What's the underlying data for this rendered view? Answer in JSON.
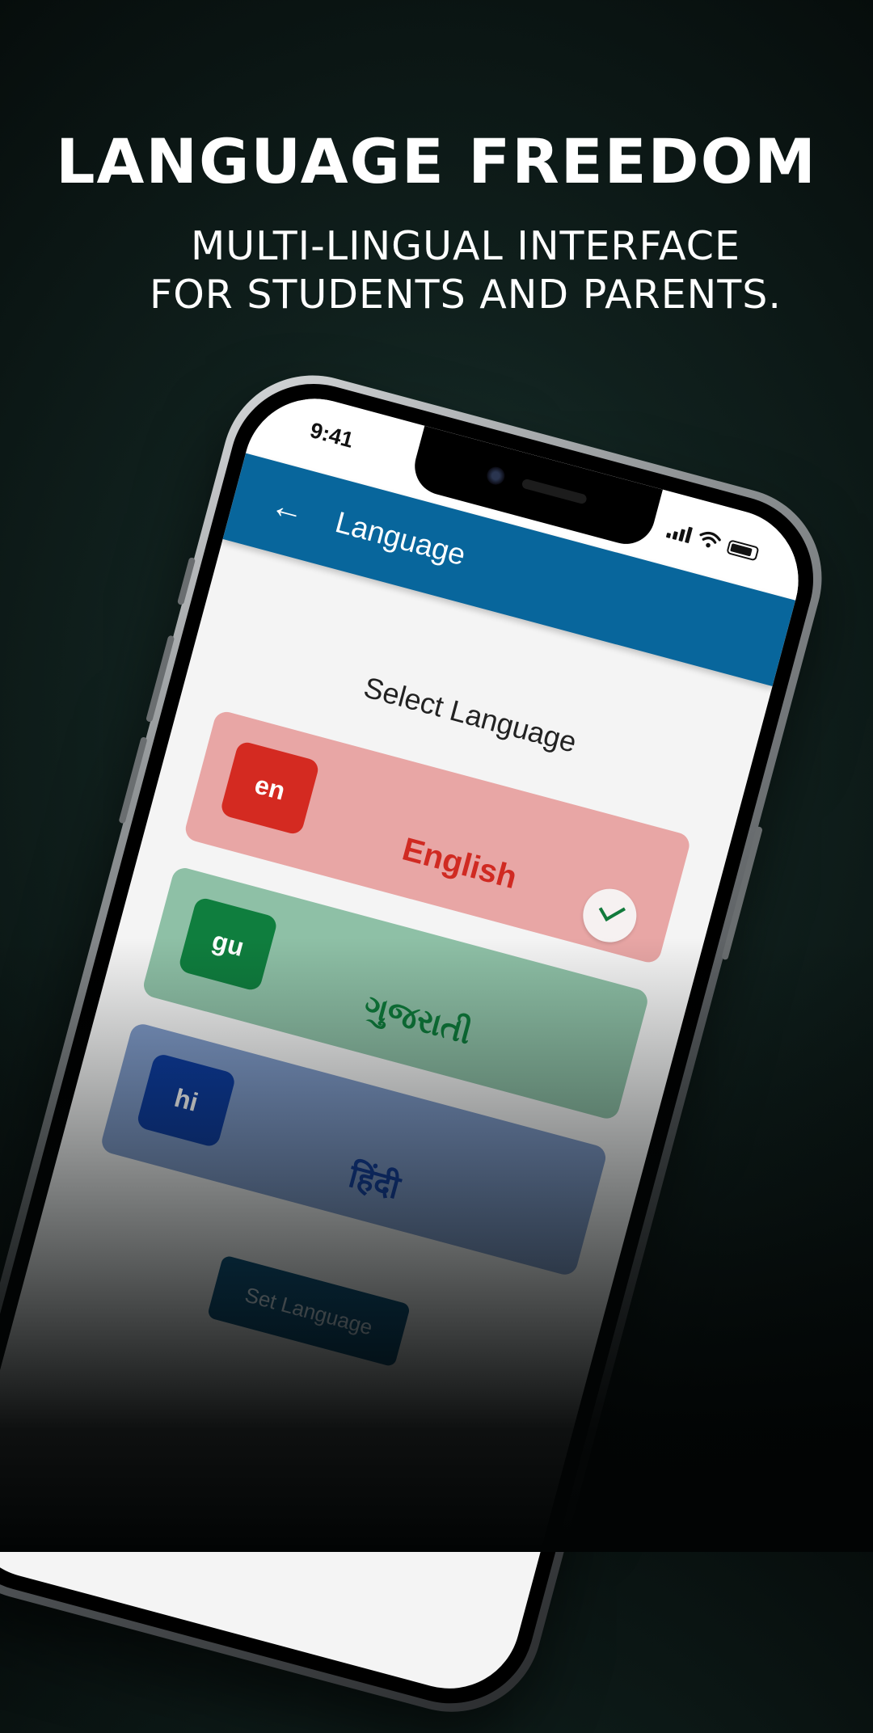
{
  "headline": {
    "title": "LANGUAGE FREEDOM",
    "subtitle_line1": "MULTI-LINGUAL INTERFACE",
    "subtitle_line2": "FOR STUDENTS AND PARENTS."
  },
  "status_bar": {
    "time": "9:41"
  },
  "app_bar": {
    "back_icon": "arrow-left-icon",
    "back_glyph": "←",
    "title": "Language",
    "color": "#08669c"
  },
  "content": {
    "heading": "Select Language",
    "languages": [
      {
        "code": "en",
        "name": "English",
        "selected": true,
        "color": "#d42a21"
      },
      {
        "code": "gu",
        "name": "ગુજરાતી",
        "selected": false,
        "color": "#0f7e3e"
      },
      {
        "code": "hi",
        "name": "हिंदी",
        "selected": false,
        "color": "#0d3ca0"
      }
    ],
    "set_button_label": "Set Language"
  }
}
